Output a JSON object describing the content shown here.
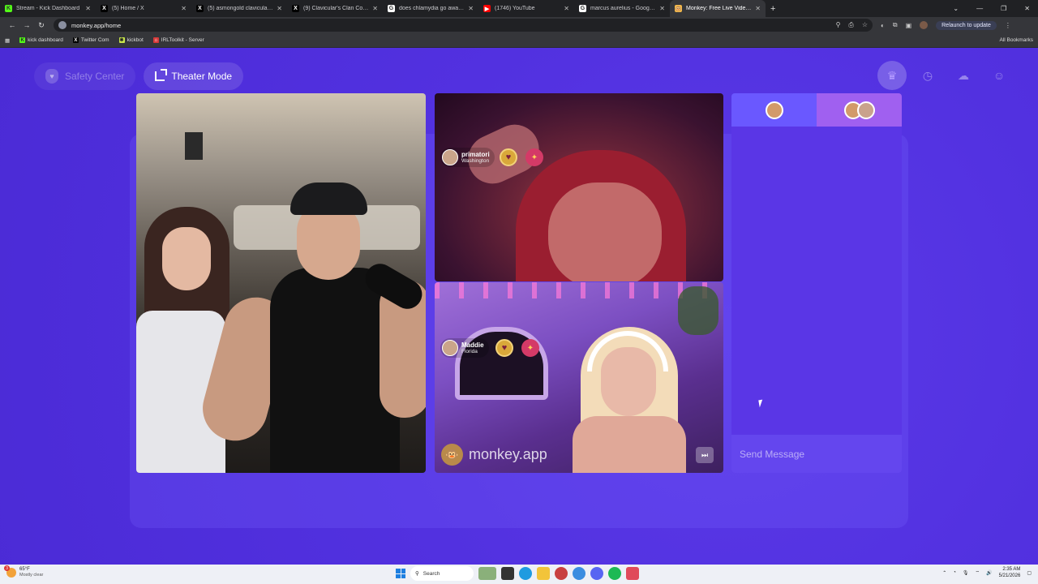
{
  "browser": {
    "tabs": [
      {
        "title": "Stream - Kick Dashboard",
        "fav_color": "#53fc18",
        "fav_glyph": "K"
      },
      {
        "title": "(5) Home / X",
        "fav_color": "#000000",
        "fav_glyph": "X"
      },
      {
        "title": "(5) asmongold clavicular - Sear",
        "fav_color": "#000000",
        "fav_glyph": "X"
      },
      {
        "title": "(9) Clavicular's Clan Communit",
        "fav_color": "#000000",
        "fav_glyph": "X"
      },
      {
        "title": "does chlamydia go away - Goo",
        "fav_color": "#ffffff",
        "fav_glyph": "G"
      },
      {
        "title": "(1746) YouTube",
        "fav_color": "#ff0000",
        "fav_glyph": "▶"
      },
      {
        "title": "marcus aurelius - Google Sear",
        "fav_color": "#ffffff",
        "fav_glyph": "G"
      },
      {
        "title": "Monkey: Free Live Video C",
        "fav_color": "#f2b84b",
        "fav_glyph": "🐵",
        "active": true
      }
    ],
    "new_tab": "+",
    "url": "monkey.app/home",
    "relaunch_label": "Relaunch to update",
    "bookmarks": [
      {
        "label": "kick dashboard",
        "color": "#53fc18",
        "glyph": "K"
      },
      {
        "label": "Twitter Com",
        "color": "#000000",
        "glyph": "X"
      },
      {
        "label": "kickbot",
        "color": "#c8e64a",
        "glyph": "✱"
      },
      {
        "label": "IRLToolkit - Server",
        "color": "#d63a3a",
        "glyph": "⌂"
      }
    ],
    "all_bookmarks": "All Bookmarks"
  },
  "page": {
    "safety_label": "Safety Center",
    "theater_label": "Theater Mode",
    "right_icons": [
      "crown-icon",
      "clock-icon",
      "chat-icon",
      "monkey-icon"
    ]
  },
  "videos": {
    "top": {
      "username": "primatori",
      "location": "Washington"
    },
    "bottom": {
      "username": "Maddie",
      "location": "Florida"
    },
    "watermark": "monkey.app"
  },
  "chat": {
    "placeholder": "Send Message"
  },
  "taskbar": {
    "temp": "65°F",
    "weather": "Mostly clear",
    "badge": "3",
    "search": "Search",
    "time": "2:35 AM",
    "date": "5/21/2026"
  }
}
